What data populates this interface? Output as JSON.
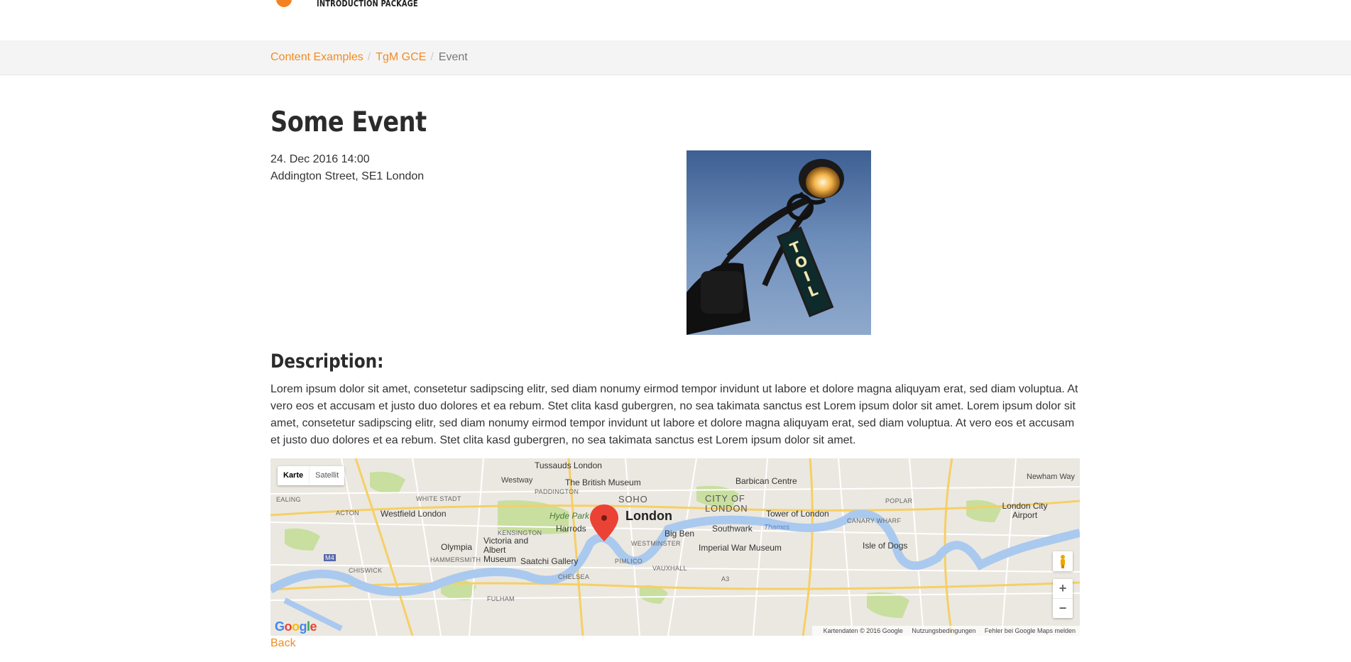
{
  "header": {
    "logo_text": "INTRODUCTION PACKAGE",
    "brand_color": "#f58220"
  },
  "breadcrumb": {
    "items": [
      {
        "label": "Content Examples"
      },
      {
        "label": "TgM GCE"
      },
      {
        "label": "Event"
      }
    ],
    "separator": "/"
  },
  "event": {
    "title": "Some Event",
    "datetime": "24. Dec 2016 14:00",
    "address": "Addington Street, SE1 London",
    "image_alt": "street lamp with Toilet sign"
  },
  "description": {
    "heading": "Description:",
    "text": "Lorem ipsum dolor sit amet, consetetur sadipscing elitr, sed diam nonumy eirmod tempor invidunt ut labore et dolore magna aliquyam erat, sed diam voluptua. At vero eos et accusam et justo duo dolores et ea rebum. Stet clita kasd gubergren, no sea takimata sanctus est Lorem ipsum dolor sit amet. Lorem ipsum dolor sit amet, consetetur sadipscing elitr, sed diam nonumy eirmod tempor invidunt ut labore et dolore magna aliquyam erat, sed diam voluptua. At vero eos et accusam et justo duo dolores et ea rebum. Stet clita kasd gubergren, no sea takimata sanctus est Lorem ipsum dolor sit amet."
  },
  "map": {
    "type_buttons": [
      "Karte",
      "Satellit"
    ],
    "selected_type": "Karte",
    "google_logo": "Google",
    "footer": [
      "Kartendaten © 2016 Google",
      "Nutzungsbedingungen",
      "Fehler bei Google Maps melden"
    ],
    "zoom_in": "+",
    "zoom_out": "−",
    "labels": {
      "tussauds": "Tussauds London",
      "british_museum": "The British Museum",
      "barbican": "Barbican Centre",
      "soho": "SOHO",
      "city_of_london": "CITY OF LONDON",
      "london": "London",
      "tower": "Tower of London",
      "westfield": "Westfield London",
      "hyde_park": "Hyde Park",
      "harrods": "Harrods",
      "big_ben": "Big Ben",
      "southwark": "Southwark",
      "olympia": "Olympia",
      "va_museum": "Victoria and Albert Museum",
      "imperial_war": "Imperial War Museum",
      "saatchi": "Saatchi Gallery",
      "isle_of_dogs": "Isle of Dogs",
      "city_airport": "London City Airport",
      "paddington": "PADDINGTON",
      "white_stadt": "WHITE STADT",
      "acton": "ACTON",
      "ealing": "EALING",
      "kensington": "KENSINGTON",
      "hammersmith": "HAMMERSMITH",
      "chiswick": "CHISWICK",
      "chelsea": "CHELSEA",
      "pimlico": "PIMLICO",
      "vauxhall": "VAUXHALL",
      "westminster": "WESTMINSTER",
      "poplar": "POPLAR",
      "canary_wharf": "CANARY WHARF",
      "fulham": "FULHAM",
      "thames": "Thames",
      "westway": "Westway",
      "newham_way": "Newham Way",
      "m4": "M4",
      "a3": "A3"
    }
  },
  "back_link": "Back"
}
